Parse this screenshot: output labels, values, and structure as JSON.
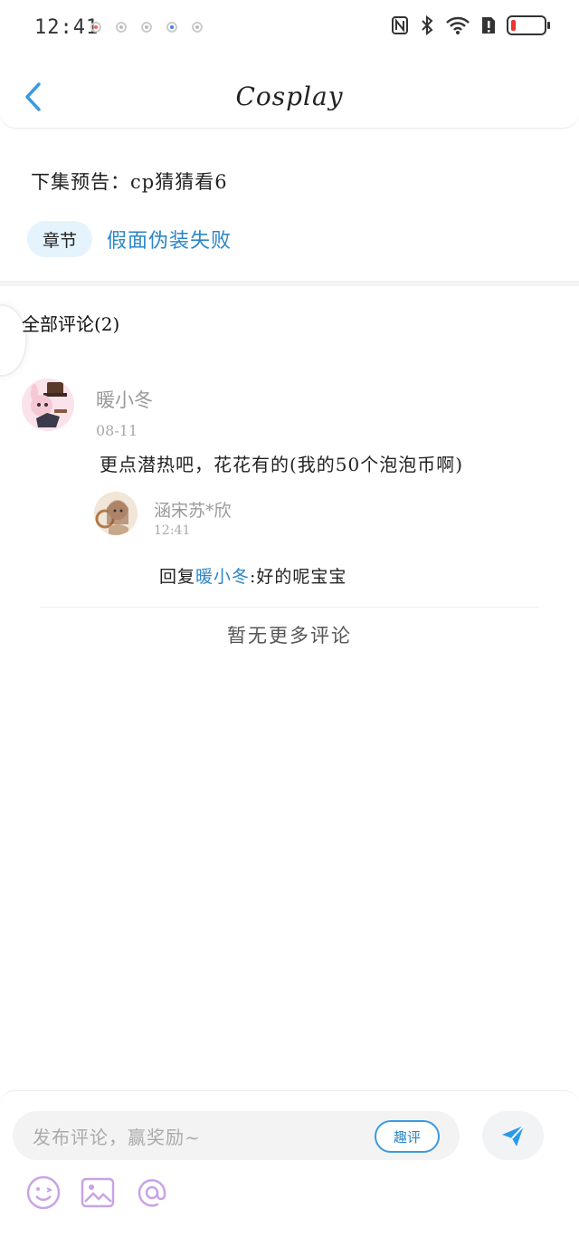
{
  "status_bar": {
    "time": "12:41"
  },
  "header": {
    "title": "Cosplay",
    "back_icon": "chevron-left-icon"
  },
  "preview": {
    "text": "下集预告：cp猜猜看6"
  },
  "chapter": {
    "pill_label": "章节",
    "link_text": "假面伪装失败"
  },
  "comments": {
    "title": "全部评论(2)",
    "items": [
      {
        "author": "暖小冬",
        "date": "08-11",
        "text": "更点潜热吧，花花有的(我的50个泡泡币啊)"
      }
    ],
    "reply": {
      "author": "涵宋苏*欣",
      "time": "12:41",
      "prefix": "回复",
      "mention": "暖小冬",
      "text": ":好的呢宝宝"
    },
    "no_more": "暂无更多评论"
  },
  "composer": {
    "placeholder": "发布评论，赢奖励~",
    "fun_button": "趣评"
  },
  "colors": {
    "accent": "#2a86c8",
    "pill_bg": "#e5f3fd",
    "icon_purple": "#c9a3e6"
  }
}
